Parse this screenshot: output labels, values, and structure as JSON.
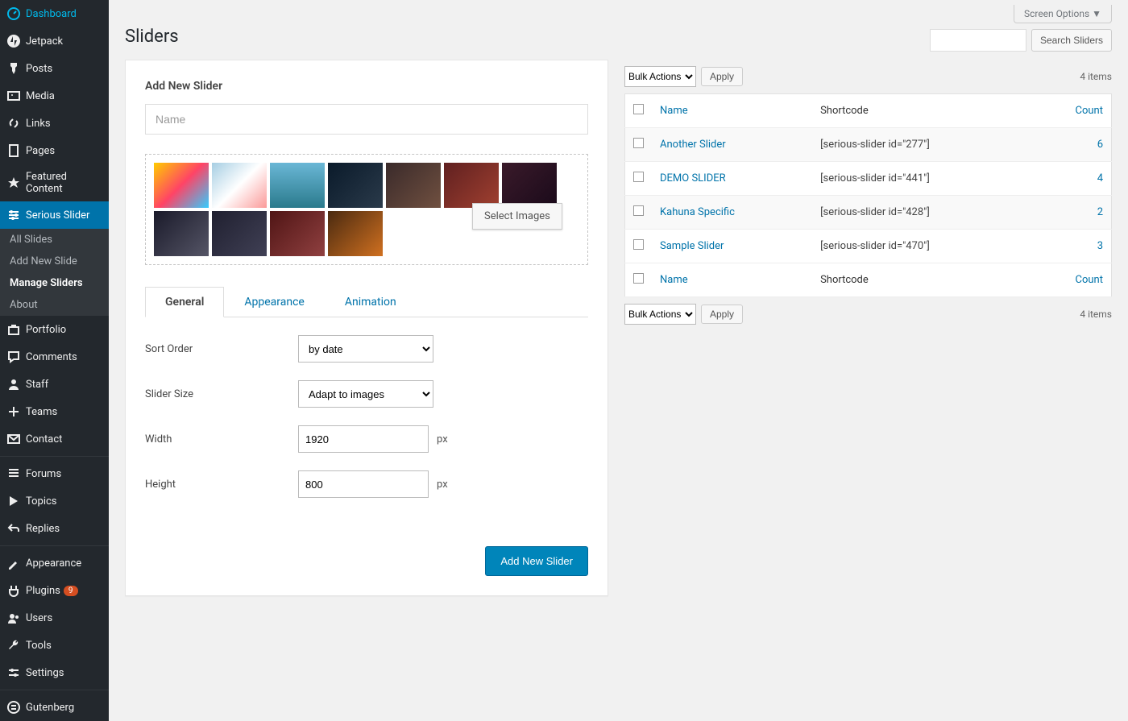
{
  "sidebar": {
    "items": [
      {
        "icon": "dashboard",
        "label": "Dashboard"
      },
      {
        "icon": "jetpack",
        "label": "Jetpack"
      },
      {
        "icon": "pin",
        "label": "Posts"
      },
      {
        "icon": "media",
        "label": "Media"
      },
      {
        "icon": "link",
        "label": "Links"
      },
      {
        "icon": "page",
        "label": "Pages"
      },
      {
        "icon": "star",
        "label": "Featured Content"
      },
      {
        "icon": "slider",
        "label": "Serious Slider",
        "active": true
      }
    ],
    "submenu": [
      {
        "label": "All Slides"
      },
      {
        "label": "Add New Slide"
      },
      {
        "label": "Manage Sliders",
        "current": true
      },
      {
        "label": "About"
      }
    ],
    "items2": [
      {
        "icon": "portfolio",
        "label": "Portfolio"
      },
      {
        "icon": "comment",
        "label": "Comments"
      },
      {
        "icon": "staff",
        "label": "Staff"
      },
      {
        "icon": "plus",
        "label": "Teams"
      },
      {
        "icon": "mail",
        "label": "Contact"
      }
    ],
    "items3": [
      {
        "icon": "forums",
        "label": "Forums"
      },
      {
        "icon": "topics",
        "label": "Topics"
      },
      {
        "icon": "replies",
        "label": "Replies"
      }
    ],
    "items4": [
      {
        "icon": "appearance",
        "label": "Appearance"
      },
      {
        "icon": "plugin",
        "label": "Plugins",
        "badge": "9"
      },
      {
        "icon": "users",
        "label": "Users"
      },
      {
        "icon": "tools",
        "label": "Tools"
      },
      {
        "icon": "settings",
        "label": "Settings"
      }
    ],
    "items5": [
      {
        "icon": "gutenberg",
        "label": "Gutenberg"
      }
    ]
  },
  "page": {
    "title": "Sliders",
    "screen_options": "Screen Options ▼"
  },
  "form": {
    "heading": "Add New Slider",
    "name_placeholder": "Name",
    "select_images": "Select Images",
    "tabs": {
      "general": "General",
      "appearance": "Appearance",
      "animation": "Animation"
    },
    "fields": {
      "sort_order": {
        "label": "Sort Order",
        "value": "by date"
      },
      "slider_size": {
        "label": "Slider Size",
        "value": "Adapt to images"
      },
      "width": {
        "label": "Width",
        "value": "1920",
        "unit": "px"
      },
      "height": {
        "label": "Height",
        "value": "800",
        "unit": "px"
      }
    },
    "submit": "Add New Slider"
  },
  "list": {
    "search_button": "Search Sliders",
    "bulk_label": "Bulk Actions",
    "apply": "Apply",
    "items_count": "4 items",
    "cols": {
      "name": "Name",
      "shortcode": "Shortcode",
      "count": "Count"
    },
    "rows": [
      {
        "name": "Another Slider",
        "shortcode": "[serious-slider id=\"277\"]",
        "count": "6"
      },
      {
        "name": "DEMO SLIDER",
        "shortcode": "[serious-slider id=\"441\"]",
        "count": "4"
      },
      {
        "name": "Kahuna Specific",
        "shortcode": "[serious-slider id=\"428\"]",
        "count": "2"
      },
      {
        "name": "Sample Slider",
        "shortcode": "[serious-slider id=\"470\"]",
        "count": "3"
      }
    ]
  }
}
